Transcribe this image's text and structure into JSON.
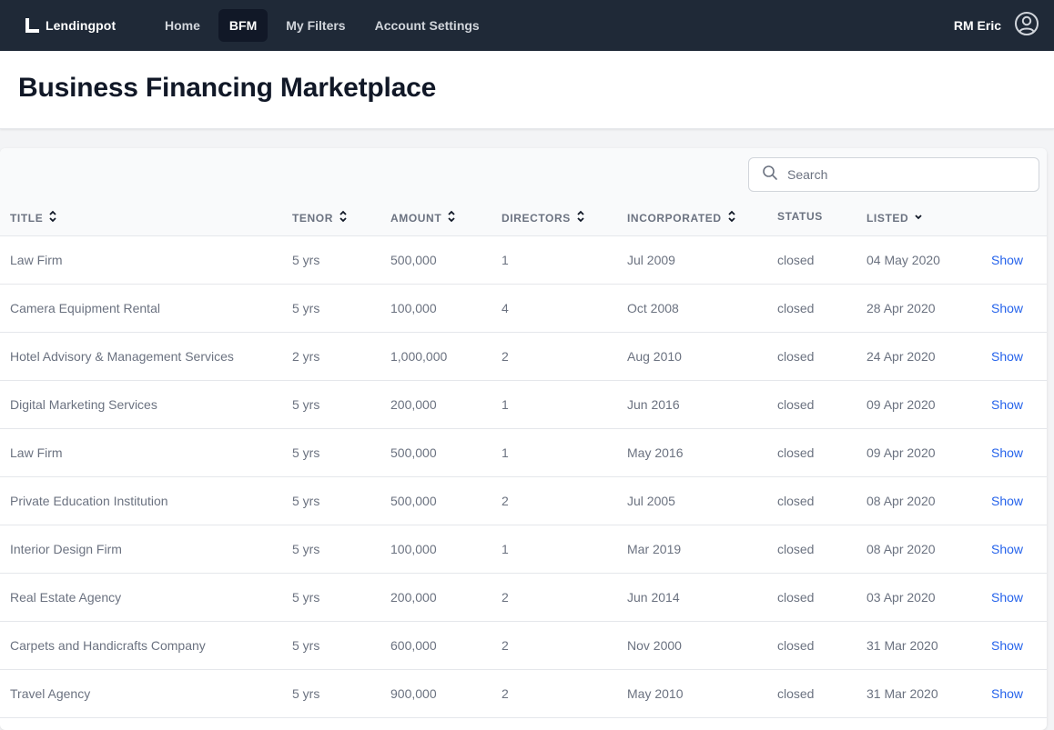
{
  "app": {
    "brand": "Lendingpot",
    "nav": [
      "Home",
      "BFM",
      "My Filters",
      "Account Settings"
    ],
    "active_nav": "BFM",
    "user_name": "RM Eric"
  },
  "page": {
    "title": "Business Financing Marketplace"
  },
  "search": {
    "placeholder": "Search",
    "value": ""
  },
  "table": {
    "columns": [
      "TITLE",
      "TENOR",
      "AMOUNT",
      "DIRECTORS",
      "INCORPORATED",
      "STATUS",
      "LISTED"
    ],
    "rows": [
      {
        "title": "Law Firm",
        "tenor": "5 yrs",
        "amount": "500,000",
        "directors": "1",
        "incorporated": "Jul 2009",
        "status": "closed",
        "listed": "04 May 2020",
        "action": "Show"
      },
      {
        "title": "Camera Equipment Rental",
        "tenor": "5 yrs",
        "amount": "100,000",
        "directors": "4",
        "incorporated": "Oct 2008",
        "status": "closed",
        "listed": "28 Apr 2020",
        "action": "Show"
      },
      {
        "title": "Hotel Advisory & Management Services",
        "tenor": "2 yrs",
        "amount": "1,000,000",
        "directors": "2",
        "incorporated": "Aug 2010",
        "status": "closed",
        "listed": "24 Apr 2020",
        "action": "Show"
      },
      {
        "title": "Digital Marketing Services",
        "tenor": "5 yrs",
        "amount": "200,000",
        "directors": "1",
        "incorporated": "Jun 2016",
        "status": "closed",
        "listed": "09 Apr 2020",
        "action": "Show"
      },
      {
        "title": "Law Firm",
        "tenor": "5 yrs",
        "amount": "500,000",
        "directors": "1",
        "incorporated": "May 2016",
        "status": "closed",
        "listed": "09 Apr 2020",
        "action": "Show"
      },
      {
        "title": "Private Education Institution",
        "tenor": "5 yrs",
        "amount": "500,000",
        "directors": "2",
        "incorporated": "Jul 2005",
        "status": "closed",
        "listed": "08 Apr 2020",
        "action": "Show"
      },
      {
        "title": "Interior Design Firm",
        "tenor": "5 yrs",
        "amount": "100,000",
        "directors": "1",
        "incorporated": "Mar 2019",
        "status": "closed",
        "listed": "08 Apr 2020",
        "action": "Show"
      },
      {
        "title": "Real Estate Agency",
        "tenor": "5 yrs",
        "amount": "200,000",
        "directors": "2",
        "incorporated": "Jun 2014",
        "status": "closed",
        "listed": "03 Apr 2020",
        "action": "Show"
      },
      {
        "title": "Carpets and Handicrafts Company",
        "tenor": "5 yrs",
        "amount": "600,000",
        "directors": "2",
        "incorporated": "Nov 2000",
        "status": "closed",
        "listed": "31 Mar 2020",
        "action": "Show"
      },
      {
        "title": "Travel Agency",
        "tenor": "5 yrs",
        "amount": "900,000",
        "directors": "2",
        "incorporated": "May 2010",
        "status": "closed",
        "listed": "31 Mar 2020",
        "action": "Show"
      }
    ]
  },
  "icons": {
    "logo": "lendingpot-logo-icon",
    "user": "user-circle-icon",
    "search": "search-icon",
    "sort": "sort-icon",
    "sort_desc": "chevron-down-icon"
  },
  "colors": {
    "nav_bg": "#1f2937",
    "nav_active_bg": "#111827",
    "link": "#2563eb",
    "title": "#111827",
    "text_muted": "#6b7280"
  }
}
